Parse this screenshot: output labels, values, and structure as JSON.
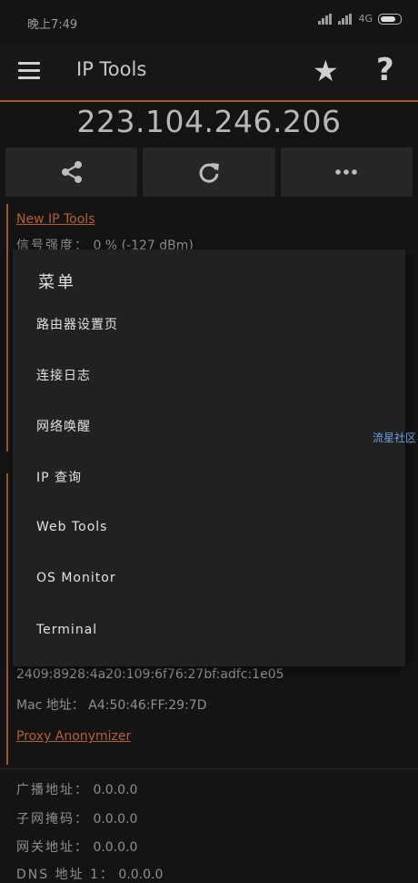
{
  "status": {
    "time": "晚上7:49",
    "network": "4G"
  },
  "appbar": {
    "title": "IP Tools",
    "favorite_icon": "star-icon",
    "help_label": "?"
  },
  "ip_address": "223.104.246.206",
  "actions": [
    {
      "name": "share",
      "icon": "share-icon"
    },
    {
      "name": "refresh",
      "icon": "refresh-icon"
    },
    {
      "name": "more",
      "icon": "more-icon"
    }
  ],
  "sections": {
    "new_ip_tools": "New IP Tools",
    "signal_label": "信号强度：",
    "signal_value": "0 % (-127 dBm)",
    "ipv6": "2409:8928:4a20:109:6f76:27bf:adfc:1e05",
    "mac_label": "Mac 地址：",
    "mac_value": "A4:50:46:FF:29:7D",
    "proxy": "Proxy Anonymizer",
    "broadcast_label": "广播地址：",
    "broadcast_value": "0.0.0.0",
    "subnet_label": "子网掩码：",
    "subnet_value": "0.0.0.0",
    "gateway_label": "网关地址：",
    "gateway_value": "0.0.0.0",
    "dns_label": "DNS 地址 1：",
    "dns_value": "0.0.0.0"
  },
  "menu": {
    "title": "菜单",
    "items": [
      "路由器设置页",
      "连接日志",
      "网络唤醒",
      "IP 查询",
      "Web Tools",
      "OS Monitor",
      "Terminal"
    ]
  },
  "watermark": "流星社区",
  "colors": {
    "accent": "#a25a2a",
    "link": "#b5602d",
    "background": "#141414",
    "menu_bg": "#212121"
  }
}
